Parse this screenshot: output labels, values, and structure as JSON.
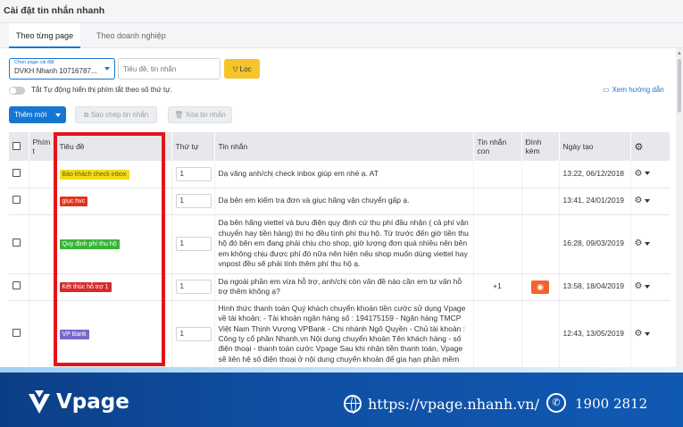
{
  "window": {
    "title": "Cài đặt tin nhắn nhanh"
  },
  "tabs": [
    {
      "label": "Theo từng page",
      "active": true
    },
    {
      "label": "Theo doanh nghiệp",
      "active": false
    }
  ],
  "filters": {
    "page_select_label": "Chọn page cài đặt",
    "page_select_value": "DVKH Nhanh 10716787...",
    "search_placeholder": "Tiêu đề, tin nhắn",
    "filter_button": "Lọc"
  },
  "toggle": {
    "label": "Tắt Tự động hiển thị phím tắt theo số thứ tự.",
    "on": false
  },
  "guide_link": "Xem hướng dẫn",
  "actions": {
    "add_new": "Thêm mới",
    "copy": "Sao chép tin nhắn",
    "delete": "Xóa tin nhắn"
  },
  "table": {
    "headers": {
      "shortcut": "Phím t",
      "title": "Tiêu đề",
      "order": "Thứ tự",
      "message": "Tin nhắn",
      "sub_message": "Tin nhắn con",
      "attachment": "Đính kèm",
      "created": "Ngày tạo"
    },
    "rows": [
      {
        "tag": "Báo khách check inbox",
        "tag_color": "#f2dc1b",
        "tag_text_color": "#6b5a00",
        "order": "1",
        "message": "Dạ vâng anh/chị check inbox giúp em nhé ạ. AT",
        "sub": "",
        "created": "13:22, 06/12/2018"
      },
      {
        "tag": "giục hvc",
        "tag_color": "#e3331b",
        "tag_text_color": "#ffffff",
        "order": "1",
        "message": "Dạ bên em kiểm tra đơn và giục hãng vận chuyển gấp ạ.",
        "sub": "",
        "created": "13:41, 24/01/2019"
      },
      {
        "tag": "Quy định phí thu hộ",
        "tag_color": "#36b537",
        "tag_text_color": "#ffffff",
        "order": "1",
        "message": "Dạ bên hãng viettel và bưu điện quy định cứ thu phí đầu nhận ( cả phí vận chuyển hay tiền hàng) thì họ đều tính phí thu hộ. Từ trước đến giờ tiền thu hộ đó bên em đang phải chịu cho shop, giờ lượng đơn quá nhiều nên bên em không chịu được phí đó nữa nên hiện nếu shop muốn dùng viettel hay vnpost đều sẽ phải tính thêm phí thu hộ ạ.",
        "sub": "",
        "created": "16:28, 09/03/2019"
      },
      {
        "tag": "Kết thúc hỗ trợ 1",
        "tag_color": "#d62b2b",
        "tag_text_color": "#ffffff",
        "order": "1",
        "message": "Dạ ngoài phần em vừa hỗ trợ, anh/chị còn vấn đề nào cần em tư vấn hỗ trợ thêm không ạ?",
        "sub": "+1",
        "created": "13:58, 18/04/2019"
      },
      {
        "tag": "VP Bank",
        "tag_color": "#7b68c9",
        "tag_text_color": "#ffffff",
        "order": "1",
        "message": "Hình thức thanh toán Quý khách chuyển khoản tiền cước sử dụng Vpage về tài khoản: - Tài khoản ngân hàng số : 194175159 - Ngân hàng TMCP Việt Nam Thịnh Vượng VPBank - Chi nhánh Ngô Quyền - Chủ tài khoản : Công ty cổ phần Nhanh.vn Nội dung chuyển khoản Tên khách hàng - số điện thoại - thanh toán cước Vpage Sau khi nhận tiền thanh toán, Vpage sẽ liên hệ số điện thoại ở nội dung chuyển khoản để gia hạn phần mềm",
        "sub": "",
        "created": "12:43, 13/05/2019"
      }
    ]
  },
  "footer": {
    "brand": "Vpage",
    "website": "https://vpage.nhanh.vn/",
    "hotline": "1900 2812"
  },
  "colors": {
    "accent": "#1677d2",
    "filter_button": "#f7c52b",
    "highlight": "#e3141b",
    "attachment_button": "#f2642f",
    "footer_bg": "#0f4fa3"
  }
}
